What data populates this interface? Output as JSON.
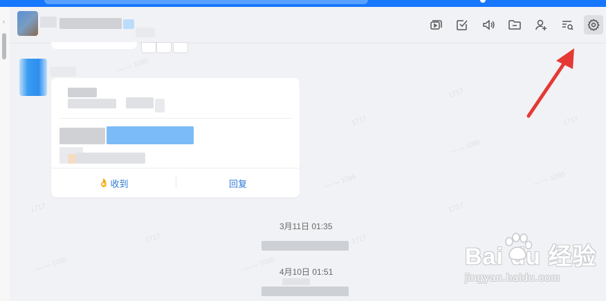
{
  "colors": {
    "accent": "#1677ff",
    "link": "#2d7ad6",
    "background": "#f1f2f5",
    "arrow": "#e53935"
  },
  "toolbar": {
    "items": [
      {
        "icon": "video-icon"
      },
      {
        "icon": "task-check-icon"
      },
      {
        "icon": "speaker-icon"
      },
      {
        "icon": "folder-icon"
      },
      {
        "icon": "add-member-icon"
      },
      {
        "icon": "search-history-icon"
      },
      {
        "icon": "gear-icon",
        "active": true
      }
    ]
  },
  "card": {
    "ack_label": "收到",
    "reply_label": "回复"
  },
  "messages": [
    {
      "time": "3月11日 01:35"
    },
    {
      "time": "4月10日 01:51"
    }
  ],
  "watermark": {
    "brand": "Bai du 经验",
    "url": "jingyan.baidu.com"
  }
}
